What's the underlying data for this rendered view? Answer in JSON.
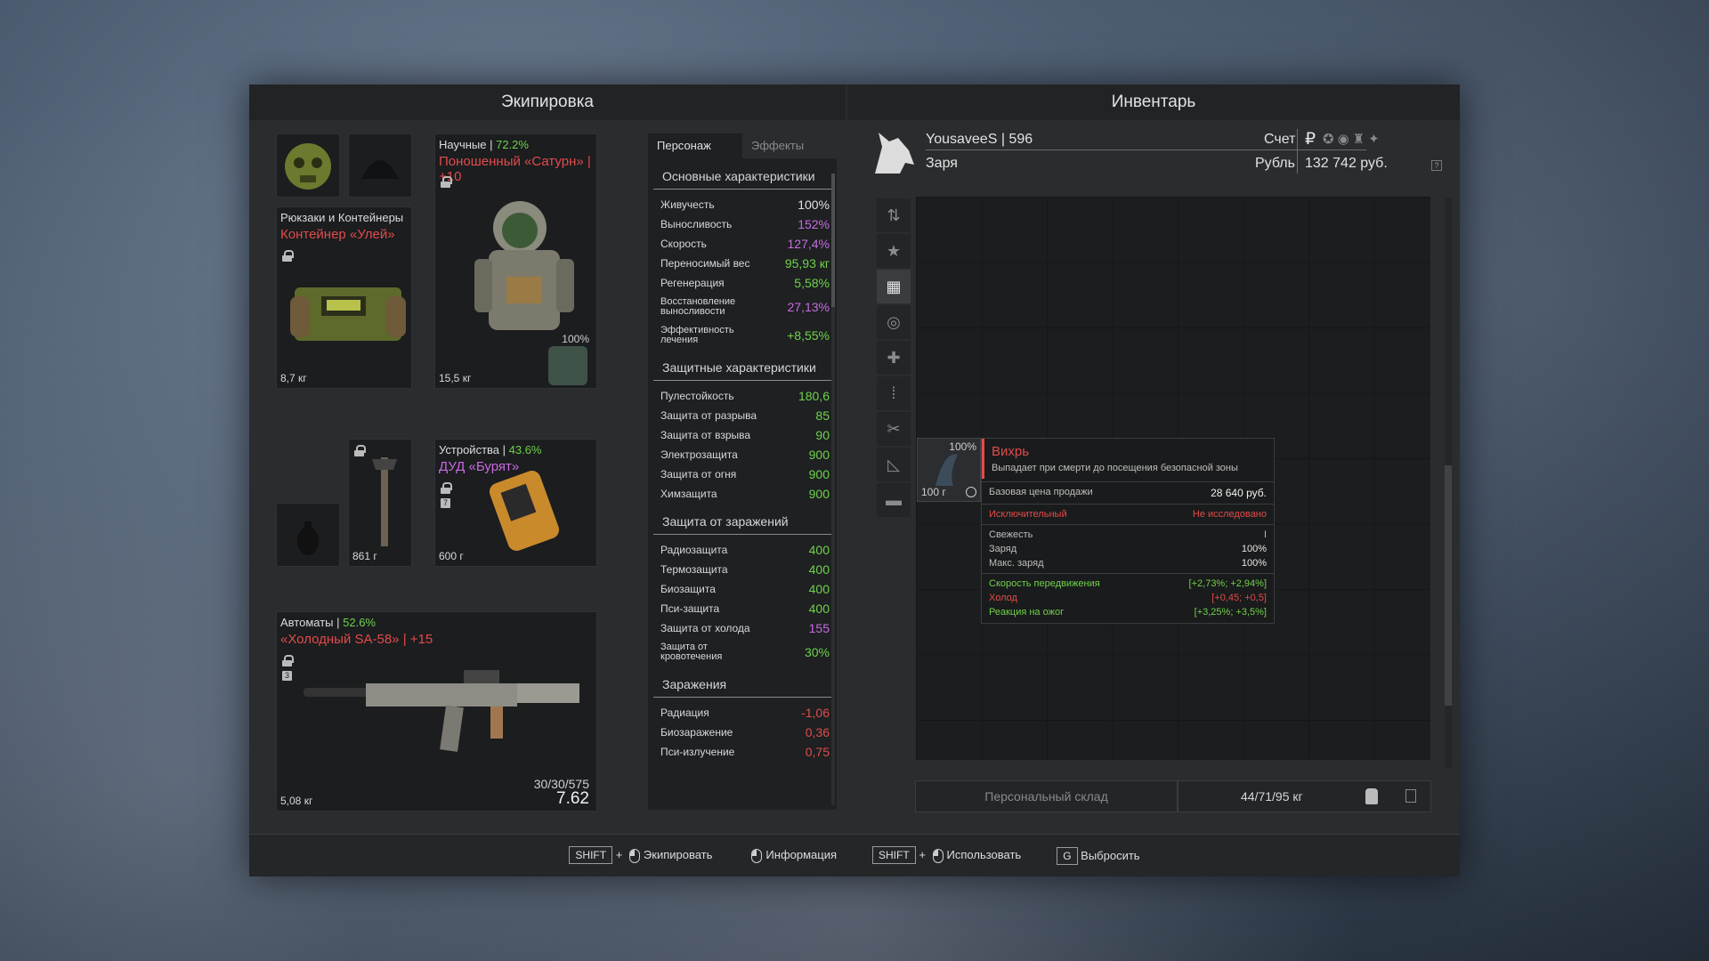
{
  "equipment": {
    "title": "Экипировка",
    "backpack": {
      "category": "Рюкзаки и Контейнеры",
      "name": "Контейнер «Улей»",
      "weight": "8,7 кг"
    },
    "armor": {
      "category": "Научные",
      "percent": "72.2%",
      "name": "Поношенный «Сатурн» | +10",
      "weight": "15,5 кг",
      "durability": "100%"
    },
    "devices": {
      "category": "Устройства",
      "percent": "43.6%",
      "name": "ДУД «Бурят»",
      "weight": "600 г",
      "slot_number": "7"
    },
    "melee": {
      "weight": "861 г"
    },
    "rifle": {
      "category": "Автоматы",
      "percent": "52.6%",
      "name": "«Холодный SA-58» | +15",
      "weight": "5,08 кг",
      "ammo": "30/30/575",
      "caliber": "7.62",
      "slot_number": "3"
    }
  },
  "stats": {
    "tabs": [
      "Персонаж",
      "Эффекты"
    ],
    "sections": [
      {
        "title": "Основные характеристики",
        "rows": [
          {
            "label": "Живучесть",
            "value": "100%",
            "color": "#e0e0e0"
          },
          {
            "label": "Выносливость",
            "value": "152%",
            "color": "#c96ae0"
          },
          {
            "label": "Скорость",
            "value": "127,4%",
            "color": "#c96ae0"
          },
          {
            "label": "Переносимый вес",
            "value": "95,93 кг",
            "color": "#6fd24a"
          },
          {
            "label": "Регенерация",
            "value": "5,58%",
            "color": "#6fd24a"
          },
          {
            "label": "Восстановление выносливости",
            "value": "27,13%",
            "color": "#c96ae0"
          },
          {
            "label": "Эффективность лечения",
            "value": "+8,55%",
            "color": "#6fd24a"
          }
        ]
      },
      {
        "title": "Защитные характеристики",
        "rows": [
          {
            "label": "Пулестойкость",
            "value": "180,6",
            "color": "#6fd24a"
          },
          {
            "label": "Защита от разрыва",
            "value": "85",
            "color": "#6fd24a"
          },
          {
            "label": "Защита от взрыва",
            "value": "90",
            "color": "#6fd24a"
          },
          {
            "label": "Электрозащита",
            "value": "900",
            "color": "#6fd24a"
          },
          {
            "label": "Защита от огня",
            "value": "900",
            "color": "#6fd24a"
          },
          {
            "label": "Химзащита",
            "value": "900",
            "color": "#6fd24a"
          }
        ]
      },
      {
        "title": "Защита от заражений",
        "rows": [
          {
            "label": "Радиозащита",
            "value": "400",
            "color": "#6fd24a"
          },
          {
            "label": "Термозащита",
            "value": "400",
            "color": "#6fd24a"
          },
          {
            "label": "Биозащита",
            "value": "400",
            "color": "#6fd24a"
          },
          {
            "label": "Пси-защита",
            "value": "400",
            "color": "#6fd24a"
          },
          {
            "label": "Защита от холода",
            "value": "155",
            "color": "#c96ae0"
          },
          {
            "label": "Защита от кровотечения",
            "value": "30%",
            "color": "#6fd24a"
          }
        ]
      },
      {
        "title": "Заражения",
        "rows": [
          {
            "label": "Радиация",
            "value": "-1,06",
            "color": "#e24b4b"
          },
          {
            "label": "Биозаражение",
            "value": "0,36",
            "color": "#e24b4b"
          },
          {
            "label": "Пси-излучение",
            "value": "0,75",
            "color": "#e24b4b"
          }
        ]
      }
    ]
  },
  "inventory": {
    "title": "Инвентарь",
    "player": "YousaveeS | 596",
    "faction": "Заря",
    "account_label": "Счет",
    "currency_label": "Рубль",
    "money": "132 742 руб.",
    "storage_label": "Персональный склад",
    "weight": "44/71/95 кг",
    "item": {
      "durability": "100%",
      "weight": "100 г"
    }
  },
  "tooltip": {
    "name": "Вихрь",
    "desc": "Выпадает при смерти до посещения безопасной зоны",
    "price_label": "Базовая цена продажи",
    "price": "28 640 руб.",
    "rarity": "Исключительный",
    "research": "Не исследовано",
    "freshness_label": "Свежесть",
    "freshness": "I",
    "charge_label": "Заряд",
    "charge": "100%",
    "max_charge_label": "Макс. заряд",
    "max_charge": "100%",
    "effects": [
      {
        "label": "Скорость передвижения",
        "value": "[+2,73%; +2,94%]",
        "color": "#6fd24a"
      },
      {
        "label": "Холод",
        "value": "[+0,45; +0,5]",
        "color": "#e24b4b"
      },
      {
        "label": "Реакция на ожог",
        "value": "[+3,25%; +3,5%]",
        "color": "#6fd24a"
      }
    ]
  },
  "footer": {
    "equip": "Экипировать",
    "info": "Информация",
    "use": "Использовать",
    "drop": "Выбросить",
    "shift": "SHIFT",
    "g": "G",
    "plus": "+"
  }
}
